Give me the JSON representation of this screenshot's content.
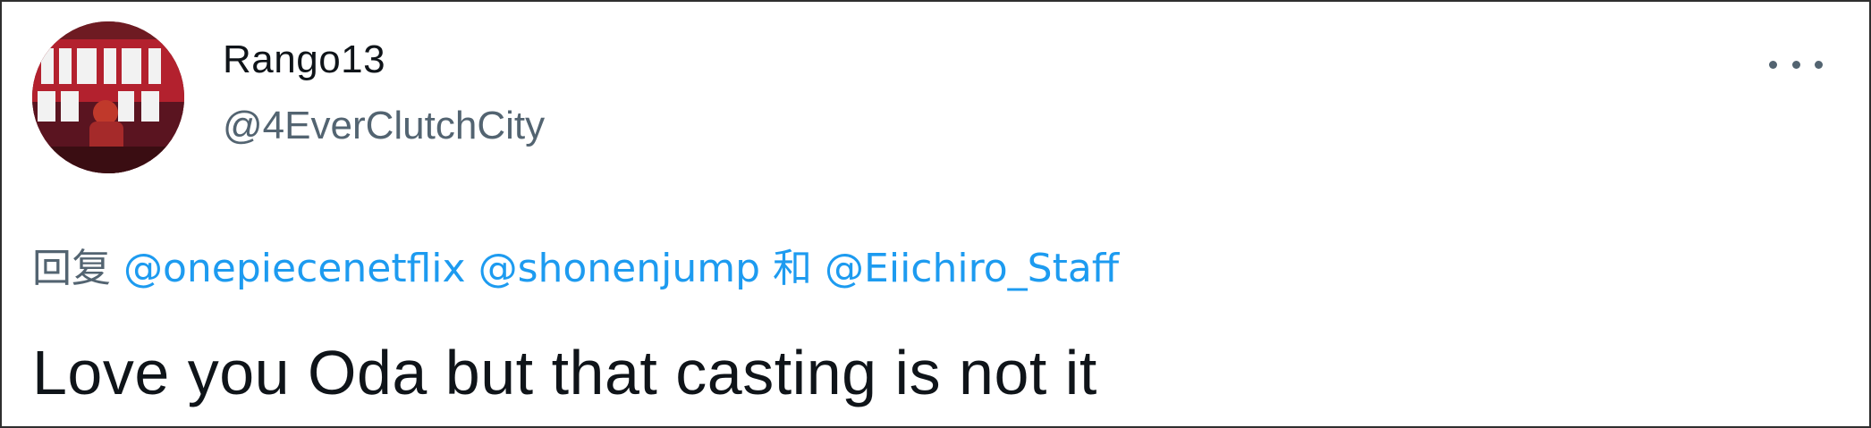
{
  "tweet": {
    "author": {
      "display_name": "Rango13",
      "handle": "@4EverClutchCity",
      "avatar_icon": "profile-avatar"
    },
    "more_icon": "more-horizontal-icon",
    "reply": {
      "prefix": "回复",
      "mentions": [
        "@onepiecenetflix",
        "@shonenjump",
        "@Eiichiro_Staff"
      ],
      "conjunction": "和"
    },
    "text": "Love you Oda but that casting is not it"
  },
  "colors": {
    "text_primary": "#0f1419",
    "text_secondary": "#536471",
    "link": "#1d9bf0",
    "border": "#2f2f2f"
  }
}
